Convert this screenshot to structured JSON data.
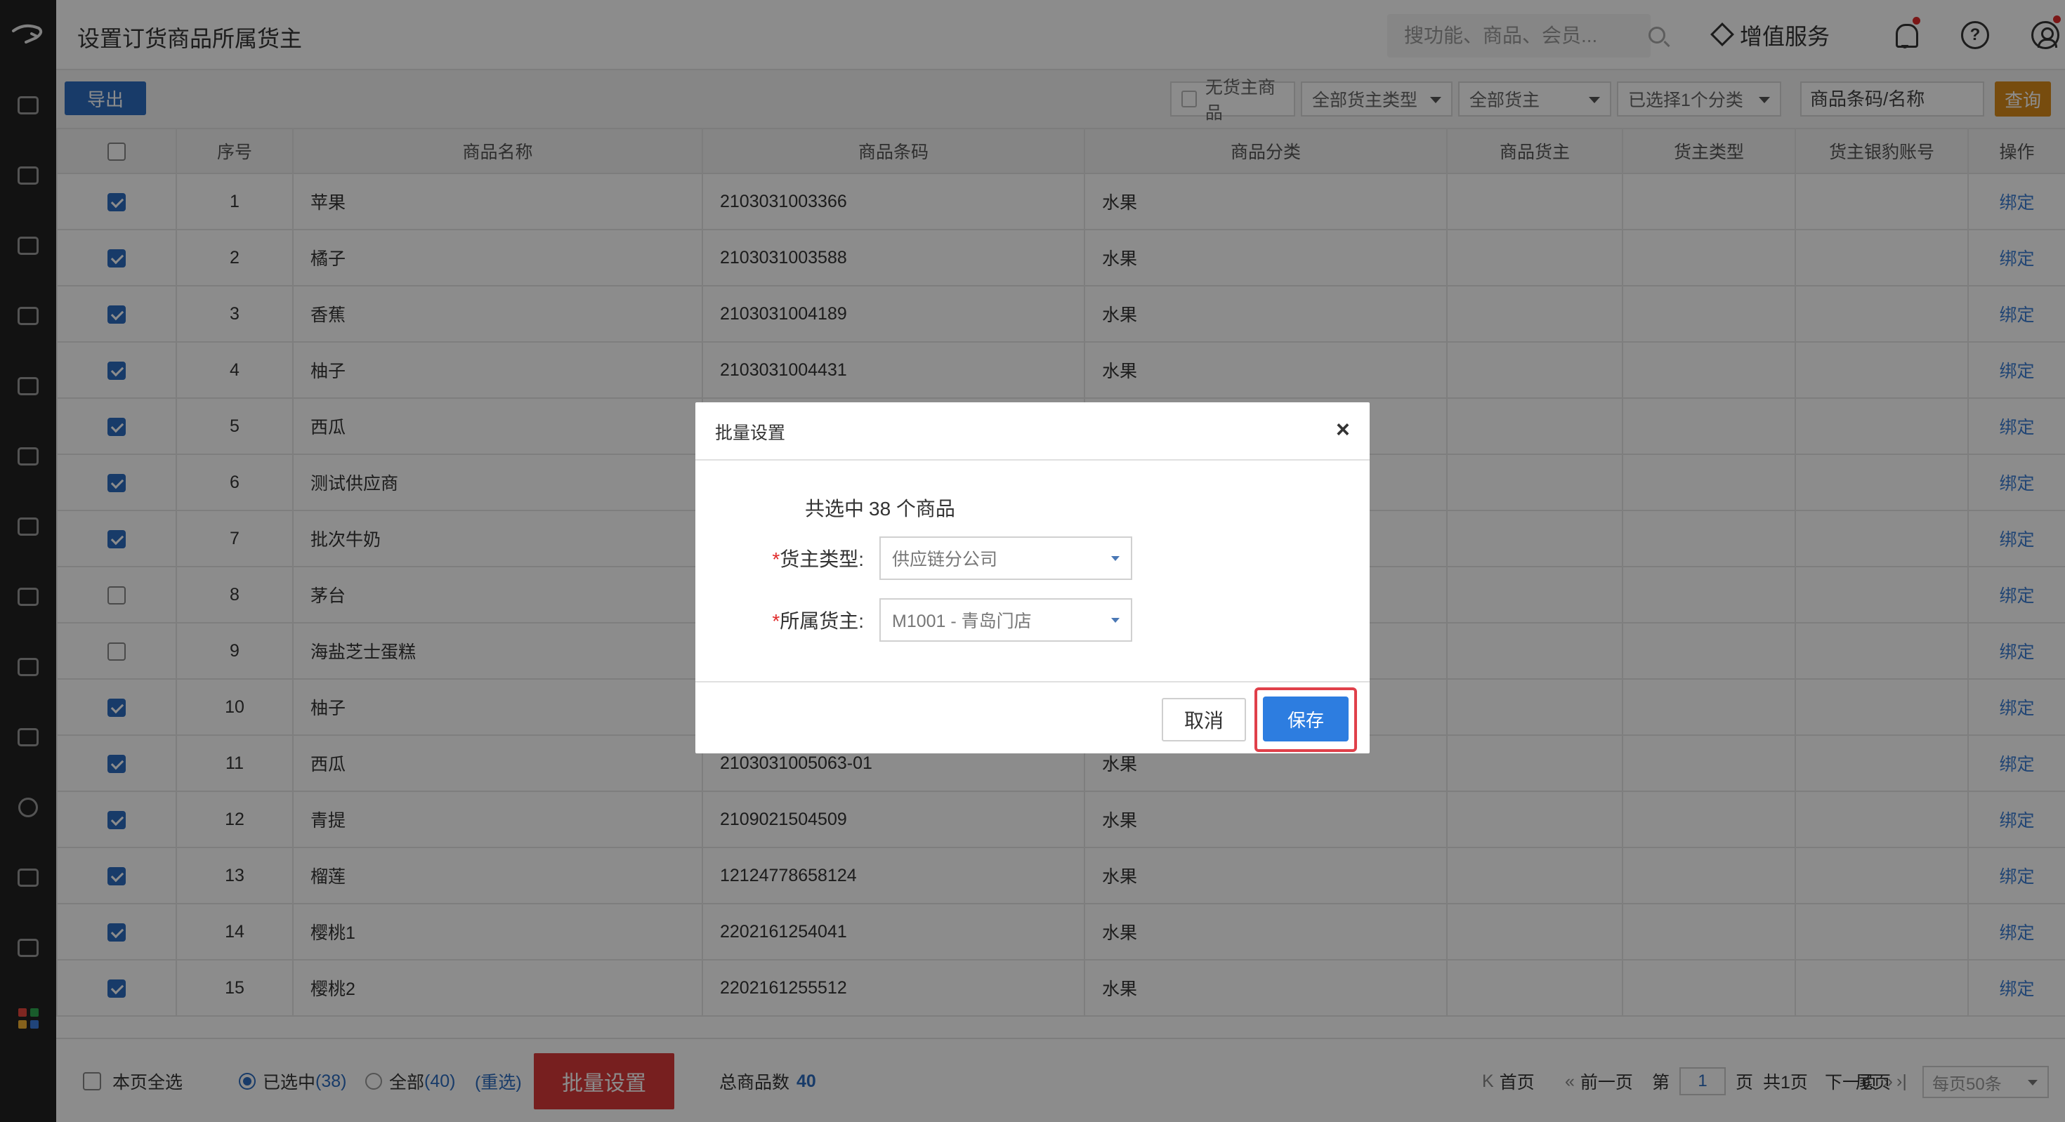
{
  "header": {
    "title": "设置订货商品所属货主",
    "search_placeholder": "搜功能、商品、会员...",
    "value_added_label": "增值服务"
  },
  "toolbar": {
    "export_label": "导出",
    "no_owner_label": "无货主商品",
    "owner_type_filter": "全部货主类型",
    "owner_filter": "全部货主",
    "category_filter": "已选择1个分类",
    "code_placeholder": "商品条码/名称",
    "query_label": "查询"
  },
  "table": {
    "columns": [
      "序号",
      "商品名称",
      "商品条码",
      "商品分类",
      "商品货主",
      "货主类型",
      "货主银豹账号",
      "操作"
    ],
    "rows": [
      {
        "no": "1",
        "name": "苹果",
        "code": "2103031003366",
        "category": "水果",
        "owner": "",
        "owner_type": "",
        "account": "",
        "action": "绑定",
        "checked": true
      },
      {
        "no": "2",
        "name": "橘子",
        "code": "2103031003588",
        "category": "水果",
        "owner": "",
        "owner_type": "",
        "account": "",
        "action": "绑定",
        "checked": true
      },
      {
        "no": "3",
        "name": "香蕉",
        "code": "2103031004189",
        "category": "水果",
        "owner": "",
        "owner_type": "",
        "account": "",
        "action": "绑定",
        "checked": true
      },
      {
        "no": "4",
        "name": "柚子",
        "code": "2103031004431",
        "category": "水果",
        "owner": "",
        "owner_type": "",
        "account": "",
        "action": "绑定",
        "checked": true
      },
      {
        "no": "5",
        "name": "西瓜",
        "code": "",
        "category": "",
        "owner": "",
        "owner_type": "",
        "account": "",
        "action": "绑定",
        "checked": true
      },
      {
        "no": "6",
        "name": "测试供应商",
        "code": "",
        "category": "",
        "owner": "",
        "owner_type": "",
        "account": "",
        "action": "绑定",
        "checked": true
      },
      {
        "no": "7",
        "name": "批次牛奶",
        "code": "",
        "category": "",
        "owner": "",
        "owner_type": "",
        "account": "",
        "action": "绑定",
        "checked": true
      },
      {
        "no": "8",
        "name": "茅台",
        "code": "",
        "category": "",
        "owner": "",
        "owner_type": "",
        "account": "",
        "action": "绑定",
        "checked": false
      },
      {
        "no": "9",
        "name": "海盐芝士蛋糕",
        "code": "",
        "category": "",
        "owner": "",
        "owner_type": "",
        "account": "",
        "action": "绑定",
        "checked": false
      },
      {
        "no": "10",
        "name": "柚子",
        "code": "",
        "category": "",
        "owner": "",
        "owner_type": "",
        "account": "",
        "action": "绑定",
        "checked": true
      },
      {
        "no": "11",
        "name": "西瓜",
        "code": "2103031005063-01",
        "category": "水果",
        "owner": "",
        "owner_type": "",
        "account": "",
        "action": "绑定",
        "checked": true
      },
      {
        "no": "12",
        "name": "青提",
        "code": "2109021504509",
        "category": "水果",
        "owner": "",
        "owner_type": "",
        "account": "",
        "action": "绑定",
        "checked": true
      },
      {
        "no": "13",
        "name": "榴莲",
        "code": "12124778658124",
        "category": "水果",
        "owner": "",
        "owner_type": "",
        "account": "",
        "action": "绑定",
        "checked": true
      },
      {
        "no": "14",
        "name": "樱桃1",
        "code": "2202161254041",
        "category": "水果",
        "owner": "",
        "owner_type": "",
        "account": "",
        "action": "绑定",
        "checked": true
      },
      {
        "no": "15",
        "name": "樱桃2",
        "code": "2202161255512",
        "category": "水果",
        "owner": "",
        "owner_type": "",
        "account": "",
        "action": "绑定",
        "checked": true
      }
    ]
  },
  "footer": {
    "select_page_label": "本页全选",
    "selected_label": "已选中",
    "selected_count": "(38)",
    "all_label": "全部",
    "all_count": "(40)",
    "reselect_label": "(重选)",
    "batch_label": "批量设置",
    "total_label": "总商品数",
    "total_count": "40",
    "first_label": "首页",
    "prev_label": "前一页",
    "page_prefix": "第",
    "page_value": "1",
    "page_suffix": "页",
    "page_total": "共1页",
    "next_label": "下一页",
    "last_label": "尾页",
    "per_page": "每页50条"
  },
  "modal": {
    "title": "批量设置",
    "close": "×",
    "selected_prefix": "共选中",
    "selected_text": "38 个商品",
    "required_mark": "*",
    "owner_type_label": "货主类型:",
    "owner_type_value": "供应链分公司",
    "owner_label": "所属货主:",
    "owner_value": "M1001 - 青岛门店",
    "cancel_label": "取消",
    "save_label": "保存"
  },
  "colors": {
    "primary": "#2c6cc0",
    "danger": "#d93a3a",
    "query": "#d98a1a",
    "link": "#3d7fd4"
  }
}
